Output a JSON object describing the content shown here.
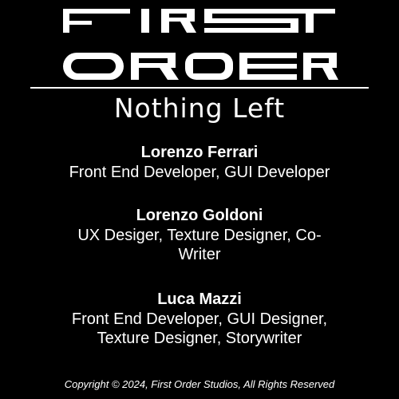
{
  "header": {
    "logo_line_1": "FIRST",
    "logo_line_2": "ORDER",
    "game_title": "Nothing Left"
  },
  "credits": [
    {
      "name": "Lorenzo Ferrari",
      "role": "Front End Developer, GUI Developer"
    },
    {
      "name": "Lorenzo Goldoni",
      "role": "UX Desiger, Texture Designer, Co-Writer"
    },
    {
      "name": "Luca Mazzi",
      "role": "Front End Developer, GUI Designer, Texture Designer, Storywriter"
    }
  ],
  "footer": {
    "copyright": "Copyright © 2024, First Order Studios, All Rights Reserved"
  },
  "colors": {
    "background": "#000000",
    "text": "#ffffff"
  }
}
